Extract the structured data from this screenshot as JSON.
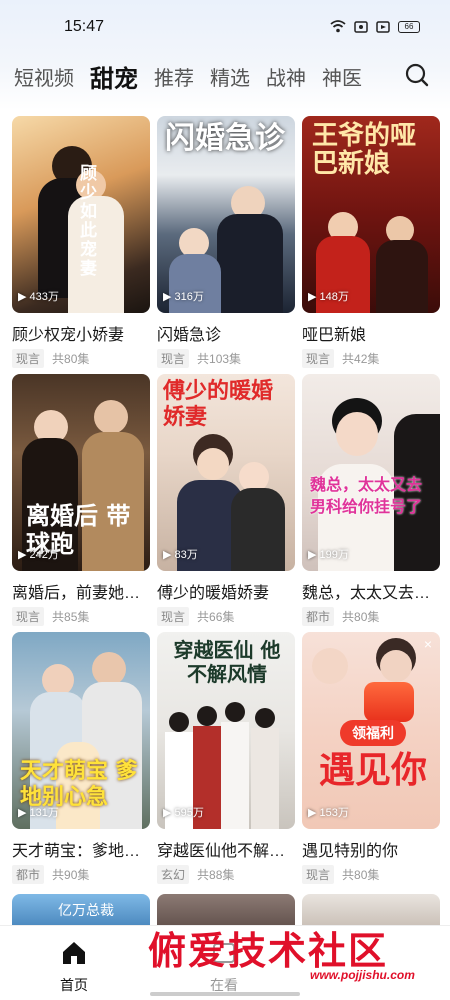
{
  "status": {
    "time": "15:47",
    "battery": "66"
  },
  "tabs": [
    "短视频",
    "甜宠",
    "推荐",
    "精选",
    "战神",
    "神医"
  ],
  "active_tab": "甜宠",
  "cards": [
    {
      "title": "顾少权宠小娇妻",
      "genre": "现言",
      "episodes": "共80集",
      "views": "433万",
      "cover_text": "顾少如此宠妻"
    },
    {
      "title": "闪婚急诊",
      "genre": "现言",
      "episodes": "共103集",
      "views": "316万",
      "cover_text": "闪婚急诊"
    },
    {
      "title": "哑巴新娘",
      "genre": "现言",
      "episodes": "共42集",
      "views": "148万",
      "cover_text": "王爷的哑巴新娘"
    },
    {
      "title": "离婚后，前妻她…",
      "genre": "现言",
      "episodes": "共85集",
      "views": "242万",
      "cover_text": "离婚后 带球跑"
    },
    {
      "title": "傅少的暖婚娇妻",
      "genre": "现言",
      "episodes": "共66集",
      "views": "83万",
      "cover_text": "傅少的暖婚娇妻"
    },
    {
      "title": "魏总，太太又去…",
      "genre": "都市",
      "episodes": "共80集",
      "views": "199万",
      "cover_text": "魏总，太太又去男科给你挂号了"
    },
    {
      "title": "天才萌宝：爹地…",
      "genre": "都市",
      "episodes": "共90集",
      "views": "131万",
      "cover_text": "天才萌宝 爹地别心急"
    },
    {
      "title": "穿越医仙他不解…",
      "genre": "玄幻",
      "episodes": "共88集",
      "views": "595万",
      "cover_text": "穿越医仙 他不解风情"
    },
    {
      "title": "遇见特别的你",
      "genre": "现言",
      "episodes": "共80集",
      "views": "153万",
      "cover_text": "遇见你",
      "badge": "领福利"
    }
  ],
  "partial_cover_text": "亿万总裁",
  "nav": {
    "home": "首页",
    "watching": "在看"
  },
  "watermark": {
    "main": "俯爱技术社区",
    "sub": "www.pojjishu.com"
  }
}
